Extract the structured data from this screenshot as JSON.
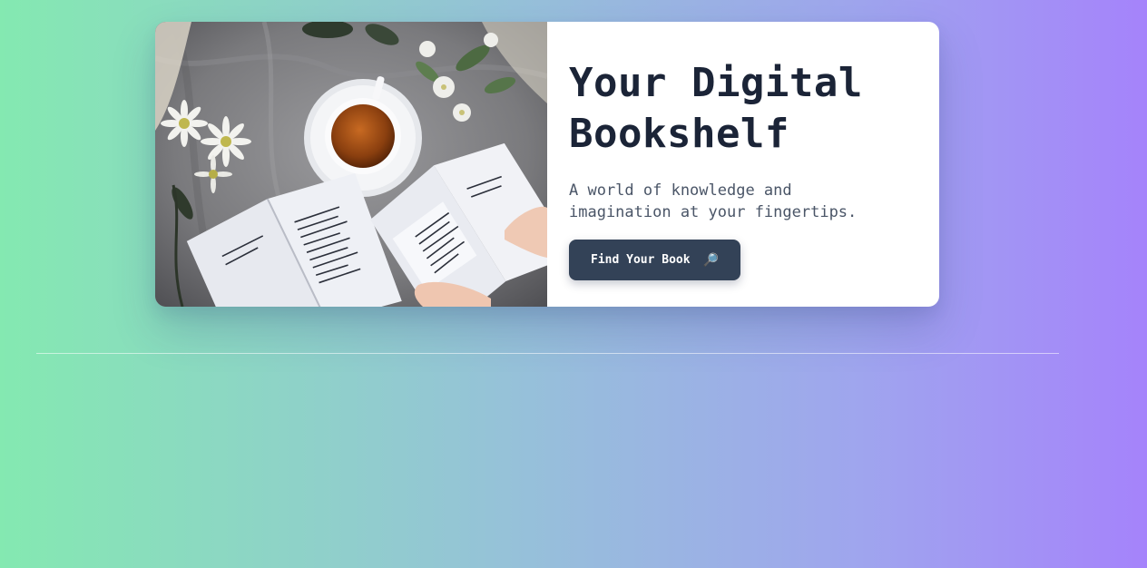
{
  "hero": {
    "title_line1": "Your Digital",
    "title_line2": "Bookshelf",
    "subtitle_line1": "A world of knowledge and",
    "subtitle_line2": "imagination at your fingertips.",
    "button_label": "Find Your Book",
    "button_icon": "🔎",
    "button_icon_name": "magnifying-glass-icon",
    "image_subject": "books-and-tea-photo"
  },
  "colors": {
    "gradient_start": "#84e9b1",
    "gradient_end": "#a583fb",
    "title": "#1b2437",
    "subtitle": "#4a5567",
    "button_bg": "#334257",
    "button_text": "#ffffff"
  }
}
